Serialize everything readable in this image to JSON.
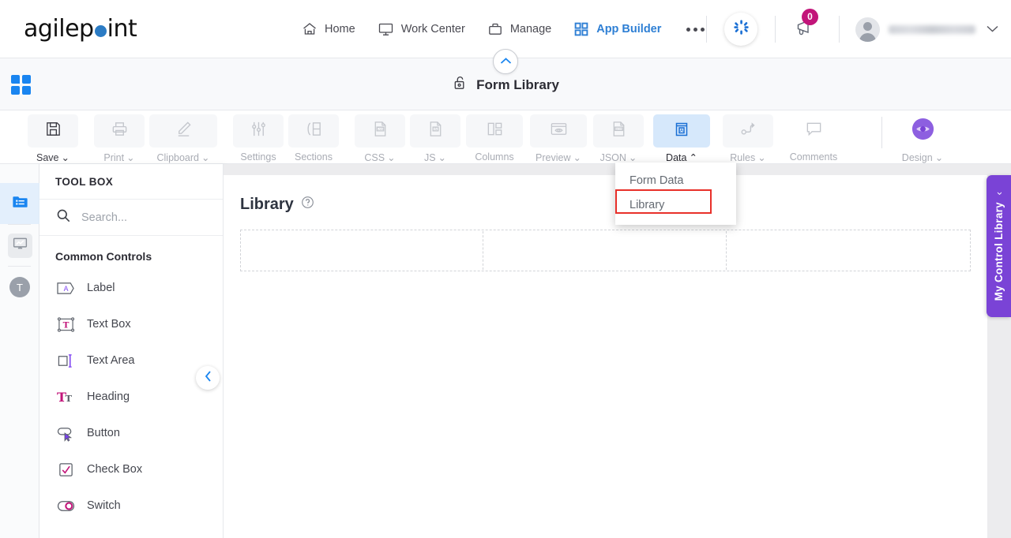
{
  "brand": {
    "name_part1": "agilep",
    "name_part2": "int",
    "dot_color": "#2b7bc4"
  },
  "header": {
    "nav": [
      {
        "label": "Home",
        "icon": "home-icon",
        "active": false
      },
      {
        "label": "Work Center",
        "icon": "monitor-icon",
        "active": false
      },
      {
        "label": "Manage",
        "icon": "briefcase-icon",
        "active": false
      },
      {
        "label": "App Builder",
        "icon": "grid-icon",
        "active": true
      }
    ],
    "more_label": "...",
    "ai_icon": "ai-sparkle-icon",
    "notifications": {
      "icon": "megaphone-icon",
      "count": "0",
      "badge_color": "#c2157a"
    },
    "user": {
      "name": "",
      "avatar_icon": "avatar-icon",
      "chevron": "⌄"
    }
  },
  "subheader": {
    "grid_icon": "app-grid-icon",
    "lock_icon": "unlock-icon",
    "title": "Form Library",
    "collapse_icon": "chevron-up-icon"
  },
  "toolbar": {
    "items": [
      {
        "label": "Save",
        "icon": "save-icon",
        "caret": "⌄",
        "state": "enabled"
      },
      {
        "label": "Print",
        "icon": "print-icon",
        "caret": "⌄",
        "state": "disabled"
      },
      {
        "label": "Clipboard",
        "icon": "pencil-icon",
        "caret": "⌄",
        "state": "disabled"
      },
      {
        "label": "Settings",
        "icon": "sliders-icon",
        "caret": "",
        "state": "disabled"
      },
      {
        "label": "Sections",
        "icon": "sections-icon",
        "caret": "",
        "state": "disabled"
      },
      {
        "label": "CSS",
        "icon": "css-file-icon",
        "caret": "⌄",
        "state": "disabled"
      },
      {
        "label": "JS",
        "icon": "js-file-icon",
        "caret": "⌄",
        "state": "disabled"
      },
      {
        "label": "Columns",
        "icon": "columns-icon",
        "caret": "",
        "state": "disabled"
      },
      {
        "label": "Preview",
        "icon": "preview-eye-icon",
        "caret": "⌄",
        "state": "disabled"
      },
      {
        "label": "JSON",
        "icon": "json-file-icon",
        "caret": "⌄",
        "state": "disabled"
      },
      {
        "label": "Data",
        "icon": "data-book-icon",
        "caret": "⌃",
        "state": "active"
      },
      {
        "label": "Rules",
        "icon": "rules-icon",
        "caret": "⌄",
        "state": "disabled"
      },
      {
        "label": "Comments",
        "icon": "comment-icon",
        "caret": "",
        "state": "disabled"
      }
    ],
    "design": {
      "label": "Design",
      "caret": "⌄",
      "icon": "design-eye-icon",
      "color": "#8d5fe0"
    }
  },
  "dropdown": {
    "items": [
      {
        "label": "Form Data",
        "highlighted": false
      },
      {
        "label": "Library",
        "highlighted": true
      }
    ],
    "highlight_color": "#e8302a"
  },
  "rail": {
    "items": [
      {
        "icon": "form-controls-icon",
        "selected": true
      },
      {
        "icon": "chart-icon",
        "selected": false
      },
      {
        "icon": "text-circle-icon",
        "selected": false
      }
    ]
  },
  "toolbox": {
    "header": "TOOL BOX",
    "search": {
      "placeholder": "Search...",
      "value": "",
      "icon": "search-icon"
    },
    "group_label": "Common Controls",
    "controls": [
      {
        "label": "Label",
        "icon": "label-icon"
      },
      {
        "label": "Text Box",
        "icon": "text-box-icon"
      },
      {
        "label": "Text Area",
        "icon": "text-area-icon"
      },
      {
        "label": "Heading",
        "icon": "heading-icon"
      },
      {
        "label": "Button",
        "icon": "button-icon"
      },
      {
        "label": "Check Box",
        "icon": "check-box-icon"
      },
      {
        "label": "Switch",
        "icon": "switch-icon"
      }
    ],
    "collapse_icon": "chevron-left-icon"
  },
  "canvas": {
    "form_title": "Library",
    "help_icon": "help-circle-icon",
    "dropzone_count": 3
  },
  "right_panel": {
    "label": "My Control Library",
    "chevron": "‹",
    "color": "#7a43d6"
  }
}
